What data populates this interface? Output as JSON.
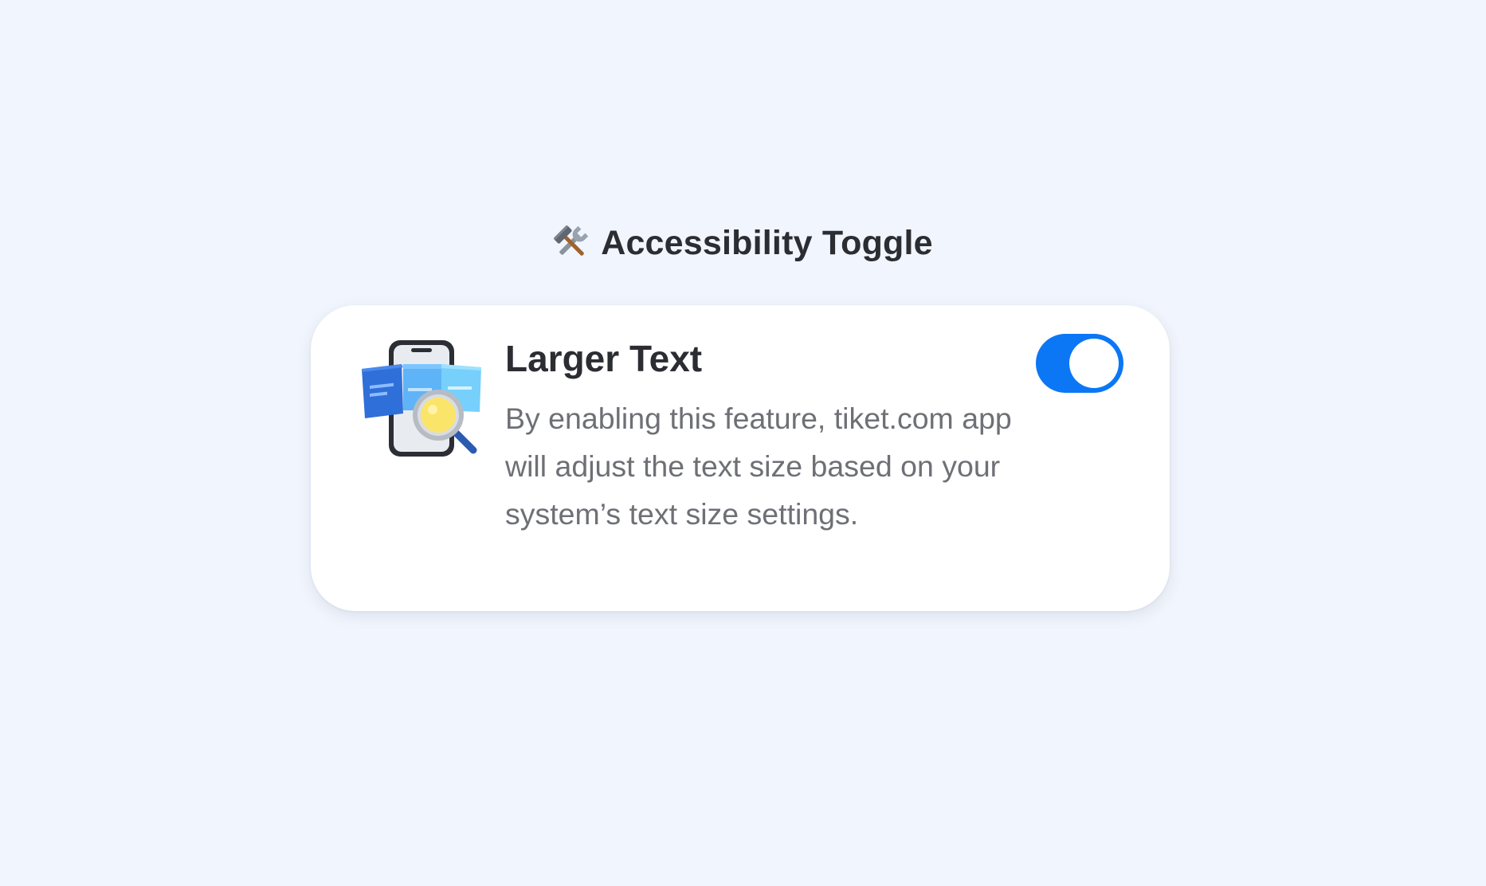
{
  "header": {
    "icon": "hammer-and-wrench-icon",
    "title": "Accessibility Toggle"
  },
  "setting": {
    "icon": "phone-magnifier-illustration-icon",
    "title": "Larger Text",
    "description": "By enabling this feature, tiket.com app will adjust the text size based on your system’s text size settings.",
    "toggle_on": true,
    "toggle_color": "#0b77f5"
  }
}
